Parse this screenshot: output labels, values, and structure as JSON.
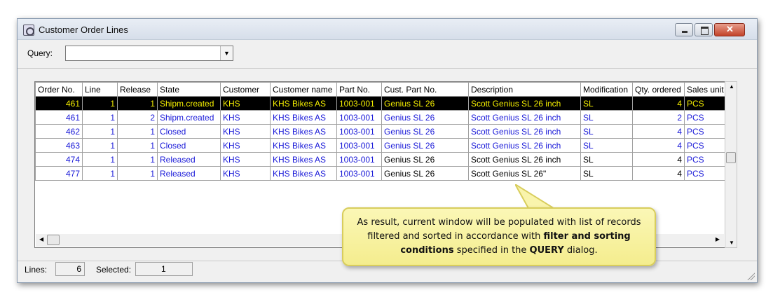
{
  "window": {
    "title": "Customer Order Lines"
  },
  "query": {
    "label": "Query:",
    "value": ""
  },
  "grid": {
    "columns": [
      "Order No.",
      "Line",
      "Release",
      "State",
      "Customer",
      "Customer name",
      "Part No.",
      "Cust. Part No.",
      "Description",
      "Modification",
      "Qty. ordered",
      "Sales unit"
    ],
    "rows": [
      [
        "461",
        "1",
        "1",
        "Shipm.created",
        "KHS",
        "KHS Bikes AS",
        "1003-001",
        "Genius SL 26",
        "Scott Genius SL 26 inch",
        "SL",
        "4",
        "PCS"
      ],
      [
        "461",
        "1",
        "2",
        "Shipm.created",
        "KHS",
        "KHS Bikes AS",
        "1003-001",
        "Genius SL 26",
        "Scott Genius SL 26 inch",
        "SL",
        "2",
        "PCS"
      ],
      [
        "462",
        "1",
        "1",
        "Closed",
        "KHS",
        "KHS Bikes AS",
        "1003-001",
        "Genius SL 26",
        "Scott Genius SL 26 inch",
        "SL",
        "4",
        "PCS"
      ],
      [
        "463",
        "1",
        "1",
        "Closed",
        "KHS",
        "KHS Bikes AS",
        "1003-001",
        "Genius SL 26",
        "Scott Genius SL 26 inch",
        "SL",
        "4",
        "PCS"
      ],
      [
        "474",
        "1",
        "1",
        "Released",
        "KHS",
        "KHS Bikes AS",
        "1003-001",
        "Genius SL 26",
        "Scott Genius SL 26 inch",
        "SL",
        "4",
        "PCS"
      ],
      [
        "477",
        "1",
        "1",
        "Released",
        "KHS",
        "KHS Bikes AS",
        "1003-001",
        "Genius SL 26",
        "Scott Genius SL 26\"",
        "SL",
        "4",
        "PCS"
      ]
    ]
  },
  "status": {
    "lines_label": "Lines:",
    "lines_value": "6",
    "selected_label": "Selected:",
    "selected_value": "1"
  },
  "callout": {
    "part1": "As result, current window will be populated with list of records filtered and sorted in accordance with ",
    "bold1": "filter and sorting conditions",
    "part2": " specified in the ",
    "bold2": "QUERY",
    "part3": " dialog."
  },
  "colors": {
    "selected_bg": "#000000",
    "selected_text": "#f6f000",
    "row_blue": "#1818d8",
    "callout_bg": "#f8f3a6"
  }
}
